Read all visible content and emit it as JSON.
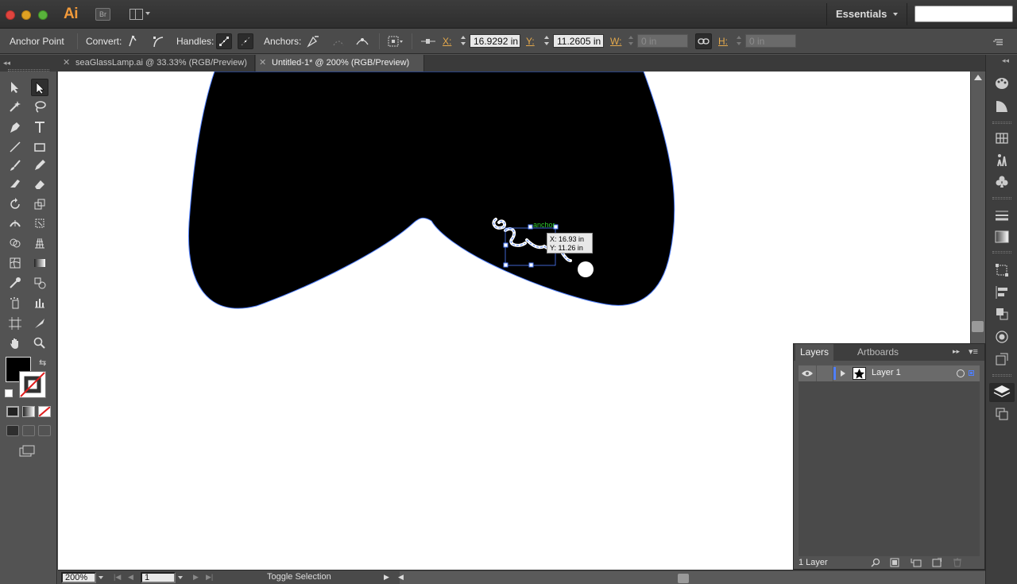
{
  "app": {
    "logo": "Ai",
    "bridge_label": "Br",
    "workspace": "Essentials",
    "search_placeholder": ""
  },
  "controlbar": {
    "tool_name": "Anchor Point",
    "convert_label": "Convert:",
    "handles_label": "Handles:",
    "anchors_label": "Anchors:",
    "x_label": "X:",
    "x_value": "16.9292 in",
    "y_label": "Y:",
    "y_value": "11.2605 in",
    "w_label": "W:",
    "w_value": "0 in",
    "h_label": "H:",
    "h_value": "0 in"
  },
  "tabs": [
    {
      "label": "seaGlassLamp.ai @ 33.33% (RGB/Preview)",
      "active": false
    },
    {
      "label": "Untitled-1* @ 200% (RGB/Preview)",
      "active": true
    }
  ],
  "canvas": {
    "smart_guide_label": "anchor",
    "tooltip_x": "X: 16.93 in",
    "tooltip_y": "Y: 11.26 in",
    "accent": "#4f7fff",
    "guide_color": "#2fcc2f"
  },
  "statusbar": {
    "zoom": "200%",
    "artboard_number": "1",
    "status_text": "Toggle Selection"
  },
  "layers_panel": {
    "tabs": [
      {
        "label": "Layers",
        "active": true
      },
      {
        "label": "Artboards",
        "active": false
      }
    ],
    "layers": [
      {
        "name": "Layer 1",
        "visible": true
      }
    ],
    "count_label": "1 Layer"
  }
}
